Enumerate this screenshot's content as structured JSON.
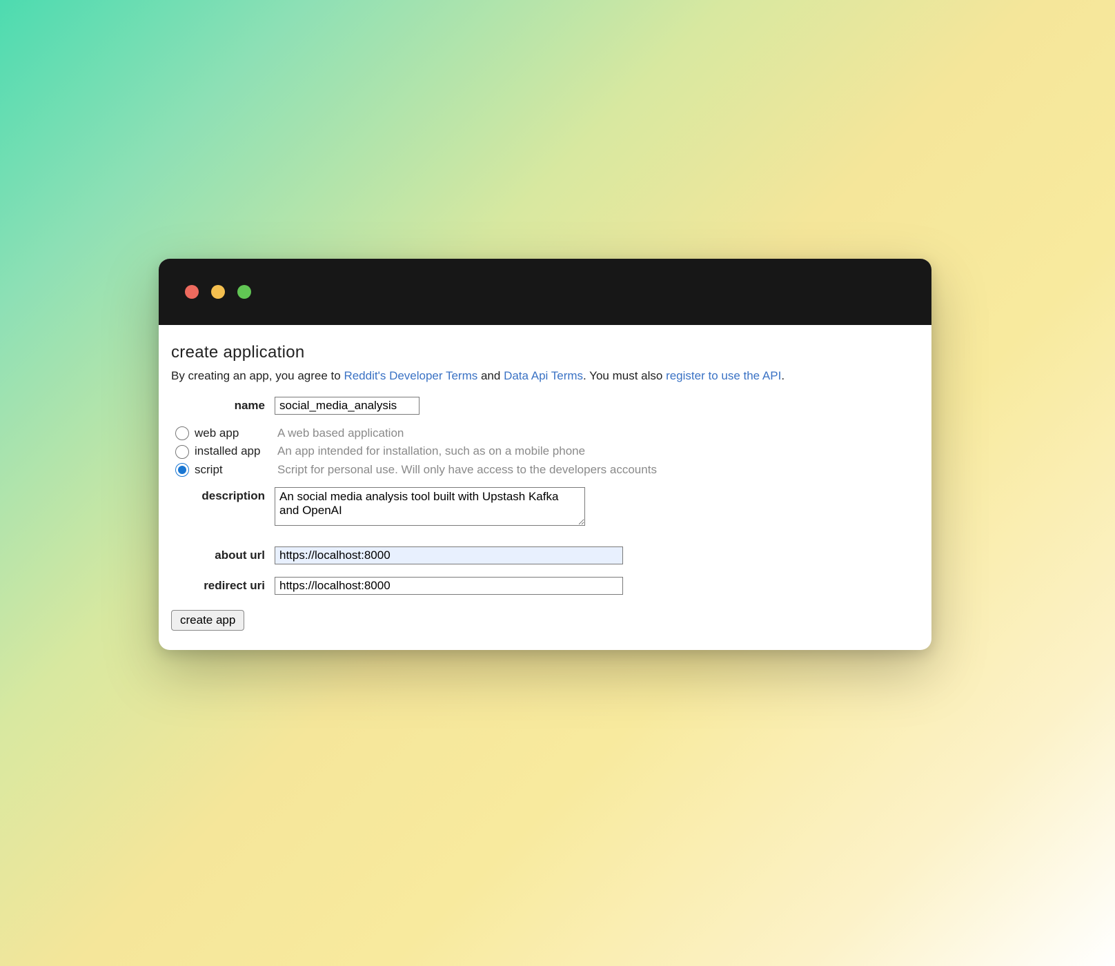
{
  "heading": "create application",
  "consent": {
    "pre": "By creating an app, you agree to ",
    "link1": "Reddit's Developer Terms",
    "mid1": " and ",
    "link2": "Data Api Terms",
    "mid2": ". You must also ",
    "link3": "register to use the API",
    "post": "."
  },
  "fields": {
    "name_label": "name",
    "name_value": "social_media_analysis",
    "description_label": "description",
    "description_value": "An social media analysis tool built with Upstash Kafka and OpenAI",
    "about_label": "about url",
    "about_value": "https://localhost:8000",
    "redirect_label": "redirect uri",
    "redirect_value": "https://localhost:8000"
  },
  "apptype": {
    "options": [
      {
        "label": "web app",
        "desc": "A web based application",
        "checked": false
      },
      {
        "label": "installed app",
        "desc": "An app intended for installation, such as on a mobile phone",
        "checked": false
      },
      {
        "label": "script",
        "desc": "Script for personal use. Will only have access to the developers accounts",
        "checked": true
      }
    ]
  },
  "button": {
    "create": "create app"
  }
}
